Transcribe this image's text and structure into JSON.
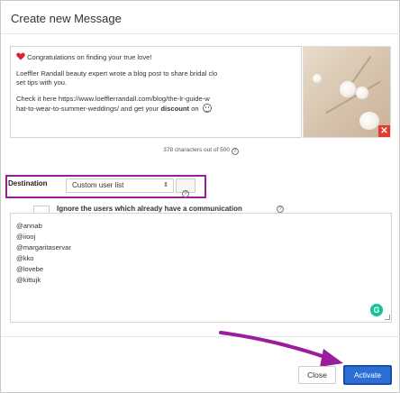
{
  "dialog": {
    "title": "Create new Message"
  },
  "message": {
    "line1": "Congratulations on finding your true love!",
    "line2a": "Loeffler Randall beauty expert wrote a blog post to share bridal clo",
    "line2b": "set tips with you.",
    "line3a": "Check it here  https://www.loefflerrandall.com/blog/the-lr-guide-w",
    "line3b_pre": "hat-to-wear-to-summer-weddings/ and get your ",
    "line3b_bold": "discount",
    "line3b_post": " on "
  },
  "char_count": {
    "text": "378 characters out of 500"
  },
  "destination": {
    "label": "Destination",
    "selected": "Custom user list",
    "arrows": "⇕"
  },
  "ignore": {
    "label": "Ignore the users which already have a communication"
  },
  "users": [
    "@annab",
    "@iiooj",
    "@margaritaservar",
    "@kko",
    "@lovebe",
    "@kittujk"
  ],
  "footer": {
    "close_label": "Close",
    "activate_label": "Activate"
  },
  "colors": {
    "highlight": "#9b1d9b",
    "primary": "#2b6fd6",
    "remove": "#e23b2e",
    "grammarly": "#15c39a"
  },
  "icons": {
    "heart": "heart-icon",
    "help": "help-circle-icon",
    "emoji": "emoji-icon",
    "remove": "close-icon",
    "grammarly": "grammarly-icon"
  }
}
